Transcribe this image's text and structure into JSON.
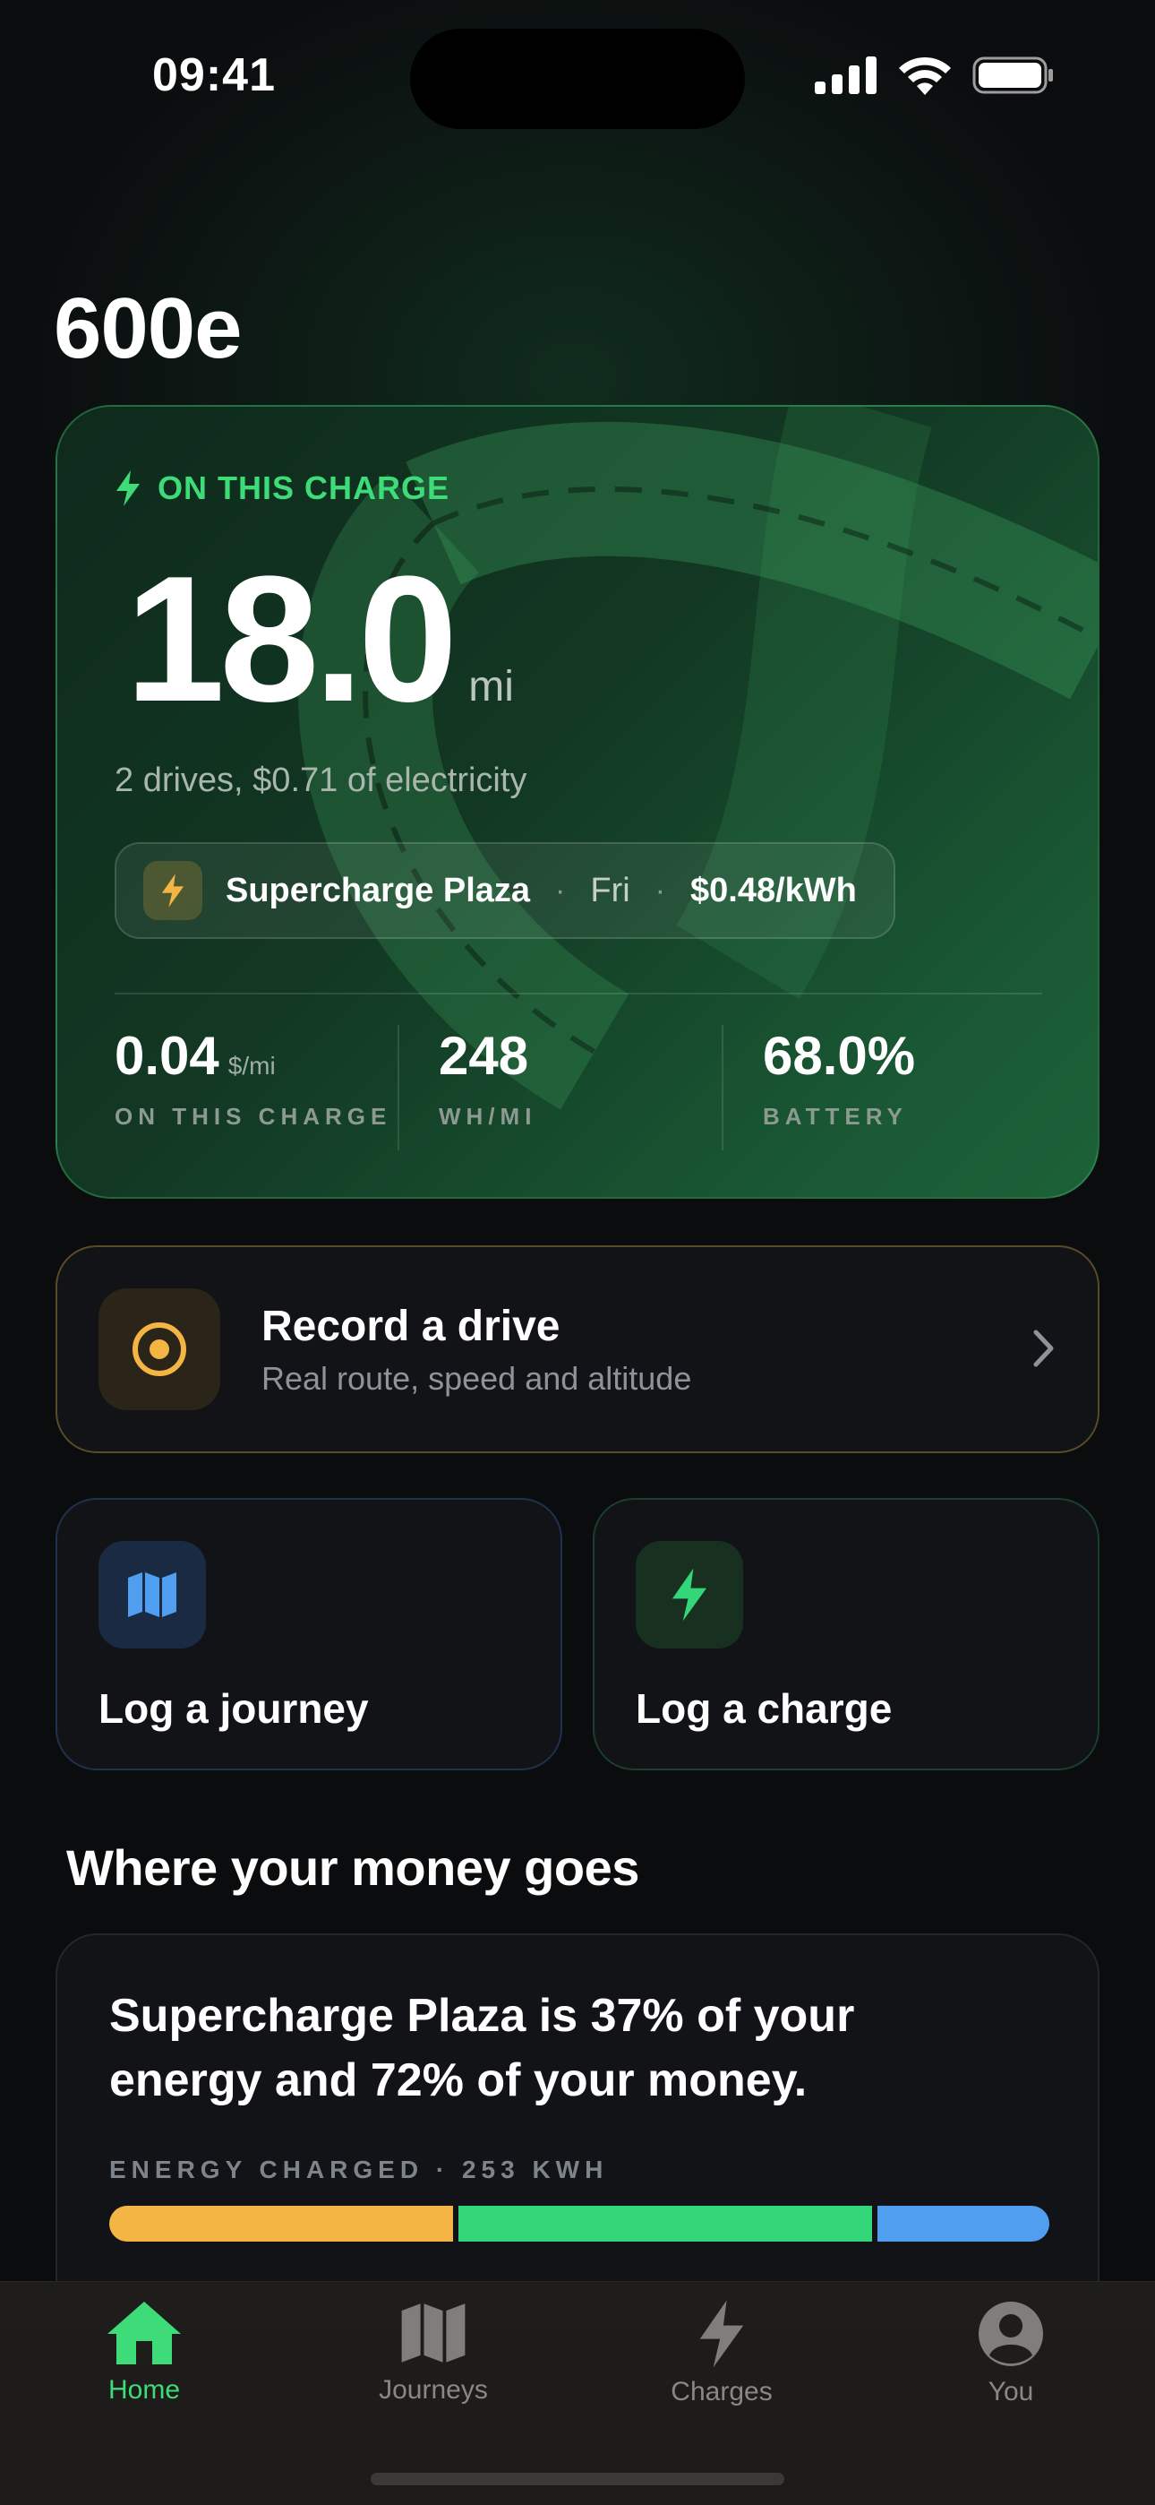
{
  "status_bar": {
    "time": "09:41"
  },
  "car": {
    "name": "600e"
  },
  "hero": {
    "label": "ON THIS CHARGE",
    "distance": "18.0",
    "distance_unit": "mi",
    "subtitle": "2 drives, $0.71 of electricity",
    "charger": {
      "name": "Supercharge Plaza",
      "day": "Fri",
      "price": "$0.48/kWh",
      "separator": "·"
    },
    "stats": [
      {
        "value": "0.04",
        "unit": "$/mi",
        "label": "ON THIS CHARGE"
      },
      {
        "value": "248",
        "unit": "",
        "label": "WH/MI"
      },
      {
        "value": "68.0%",
        "unit": "",
        "label": "BATTERY"
      }
    ]
  },
  "record": {
    "title": "Record a drive",
    "subtitle": "Real route, speed and altitude"
  },
  "tiles": {
    "journey": "Log a journey",
    "charge": "Log a charge"
  },
  "money": {
    "section_title": "Where your money goes",
    "headline": "Supercharge Plaza is 37% of your energy and 72% of your money.",
    "energy_label": "ENERGY CHARGED · 253 KWH",
    "segments": [
      {
        "share": 0.37,
        "color": "#f5b544"
      },
      {
        "share": 0.445,
        "color": "#34d67a"
      },
      {
        "share": 0.185,
        "color": "#4f9ef0"
      }
    ]
  },
  "tabs": [
    {
      "label": "Home",
      "icon": "home-icon",
      "active": true
    },
    {
      "label": "Journeys",
      "icon": "map-icon",
      "active": false
    },
    {
      "label": "Charges",
      "icon": "bolt-icon",
      "active": false
    },
    {
      "label": "You",
      "icon": "person-icon",
      "active": false
    }
  ],
  "colors": {
    "accent_green": "#3ddc78",
    "accent_amber": "#f5b544",
    "accent_blue": "#4f9ef0",
    "background": "#0b0c0e"
  }
}
